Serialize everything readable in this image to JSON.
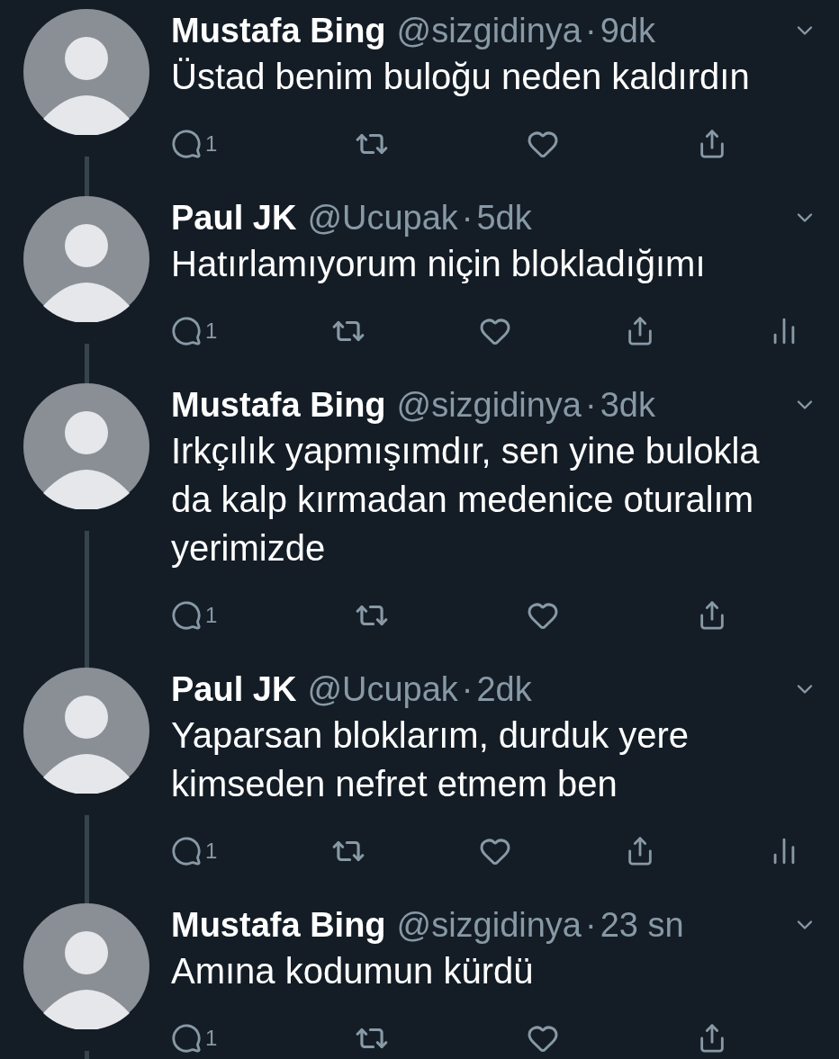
{
  "tweets": [
    {
      "name": "Mustafa Bing",
      "handle": "@sizgidinya",
      "separator": "·",
      "time": "9dk",
      "text": [
        "Üstad benim buloğu neden kaldırdın"
      ],
      "replies": "1",
      "analytics": false,
      "thread_below": true
    },
    {
      "name": "Paul JK",
      "handle": "@Ucupak",
      "separator": "·",
      "time": "5dk",
      "text": [
        "Hatırlamıyorum niçin blokladığımı"
      ],
      "replies": "1",
      "analytics": true,
      "thread_below": true
    },
    {
      "name": "Mustafa Bing",
      "handle": "@sizgidinya",
      "separator": "·",
      "time": "3dk",
      "text": [
        "Irkçılık yapmışımdır, sen yine bulokla",
        "da kalp kırmadan medenice oturalım",
        "yerimizde"
      ],
      "replies": "1",
      "analytics": false,
      "thread_below": true
    },
    {
      "name": "Paul JK",
      "handle": "@Ucupak",
      "separator": "·",
      "time": "2dk",
      "text": [
        "Yaparsan bloklarım, durduk yere",
        "kimseden nefret etmem ben"
      ],
      "replies": "1",
      "analytics": true,
      "thread_below": true
    },
    {
      "name": "Mustafa Bing",
      "handle": "@sizgidinya",
      "separator": "·",
      "time": "23 sn",
      "text": [
        "Amına kodumun kürdü"
      ],
      "replies": "1",
      "analytics": false,
      "thread_below": true
    }
  ]
}
